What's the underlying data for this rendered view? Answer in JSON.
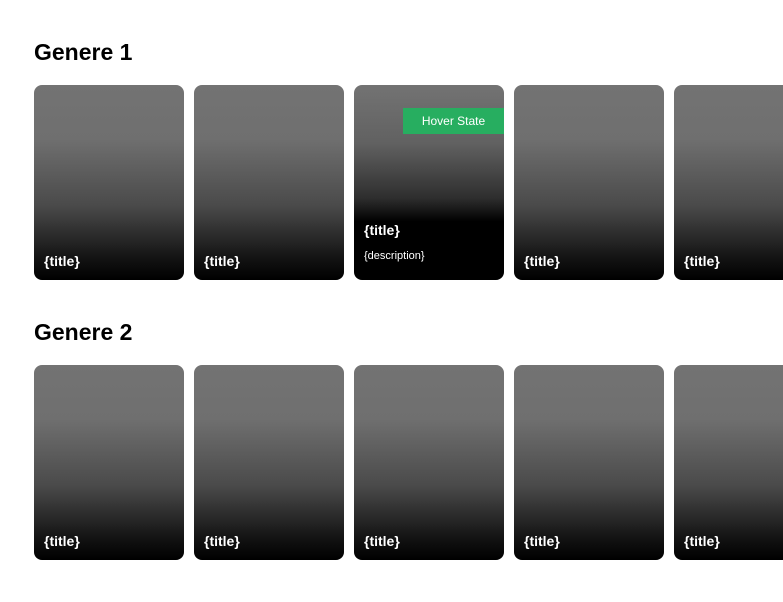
{
  "colors": {
    "badge": "#27ae60",
    "card_top": "#737373",
    "card_bottom": "#000000"
  },
  "sections": [
    {
      "title": "Genere 1",
      "cards": [
        {
          "title": "{title}"
        },
        {
          "title": "{title}"
        },
        {
          "title": "{title}",
          "description": "{description}",
          "badge": "Hover State"
        },
        {
          "title": "{title}"
        },
        {
          "title": "{title}"
        }
      ]
    },
    {
      "title": "Genere 2",
      "cards": [
        {
          "title": "{title}"
        },
        {
          "title": "{title}"
        },
        {
          "title": "{title}"
        },
        {
          "title": "{title}"
        },
        {
          "title": "{title}"
        }
      ]
    }
  ]
}
